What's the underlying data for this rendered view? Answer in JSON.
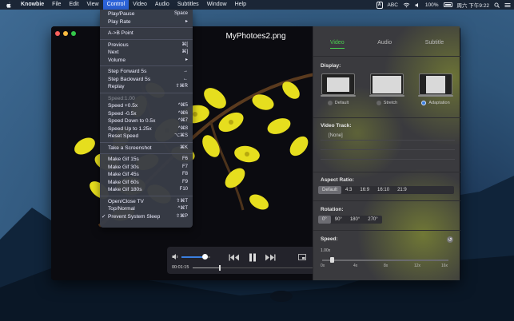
{
  "menubar": {
    "app": "Knowbie",
    "items": [
      "File",
      "Edit",
      "View",
      "Control",
      "Video",
      "Audio",
      "Subtitles",
      "Window",
      "Help"
    ],
    "active": "Control",
    "input_source": "ABC",
    "battery": "100%",
    "clock": "周六 下午9:22"
  },
  "window": {
    "title": "MyPhotoes2.png"
  },
  "player": {
    "time": "00:01:15",
    "volume": 0.8,
    "progress": 0.22
  },
  "control_menu": {
    "items": [
      {
        "label": "Play/Pause",
        "shortcut": "Space"
      },
      {
        "label": "Play Rate",
        "shortcut": "▸"
      },
      {
        "sep": true
      },
      {
        "label": "A->B Point",
        "shortcut": ""
      },
      {
        "sep": true
      },
      {
        "label": "Previous",
        "shortcut": "⌘["
      },
      {
        "label": "Next",
        "shortcut": "⌘]"
      },
      {
        "label": "Volume",
        "shortcut": "▸"
      },
      {
        "sep": true
      },
      {
        "label": "Step Forward 5s",
        "shortcut": "→"
      },
      {
        "label": "Step Backward 5s",
        "shortcut": "←"
      },
      {
        "label": "Replay",
        "shortcut": "⇧⌘R"
      },
      {
        "sep": true
      },
      {
        "label": "Speed:1.00",
        "shortcut": "",
        "disabled": true
      },
      {
        "label": "Speed +0.5x",
        "shortcut": "^⌘5"
      },
      {
        "label": "Speed -0.5x",
        "shortcut": "^⌘6"
      },
      {
        "label": "Speed Down to 0.5x",
        "shortcut": "^⌘7"
      },
      {
        "label": "Speed Up to 1.25x",
        "shortcut": "^⌘8"
      },
      {
        "label": "Reset Speed",
        "shortcut": "⌥⌘S"
      },
      {
        "sep": true
      },
      {
        "label": "Take a Screenshot",
        "shortcut": "⌘K"
      },
      {
        "sep": true
      },
      {
        "label": "Make Gif 15s",
        "shortcut": "F6"
      },
      {
        "label": "Make Gif 30s",
        "shortcut": "F7"
      },
      {
        "label": "Make Gif 45s",
        "shortcut": "F8"
      },
      {
        "label": "Make Gif 60s",
        "shortcut": "F9"
      },
      {
        "label": "Make Gif 180s",
        "shortcut": "F10"
      },
      {
        "sep": true
      },
      {
        "label": "Open/Close TV",
        "shortcut": "⇧⌘T"
      },
      {
        "label": "Top/Normal",
        "shortcut": "^⌘T"
      },
      {
        "label": "Prevent System Sleep",
        "shortcut": "⇧⌘P",
        "checked": true
      }
    ]
  },
  "panel": {
    "tabs": [
      "Video",
      "Audio",
      "Subtitle"
    ],
    "selected_tab": "Video",
    "display_heading": "Display:",
    "display_options": [
      "Default",
      "Stretch",
      "Adaptation"
    ],
    "display_selected": "Adaptation",
    "video_track_heading": "Video Track:",
    "video_tracks": [
      "[None]"
    ],
    "aspect_heading": "Aspect Ratio:",
    "aspect_options": [
      "Default",
      "4:3",
      "16:9",
      "16:10",
      "21:9"
    ],
    "aspect_selected": "Default",
    "rotation_heading": "Rotation:",
    "rotation_options": [
      "0°",
      "90°",
      "180°",
      "270°"
    ],
    "rotation_selected": "0°",
    "speed_heading": "Speed:",
    "speed_value": "1.00x",
    "speed_ticks": [
      "0x",
      "4x",
      "8x",
      "12x",
      "16x"
    ]
  },
  "colors": {
    "accent_blue": "#2c63d9",
    "tab_green": "#49d04f",
    "flower_yellow": "#e8e020"
  }
}
